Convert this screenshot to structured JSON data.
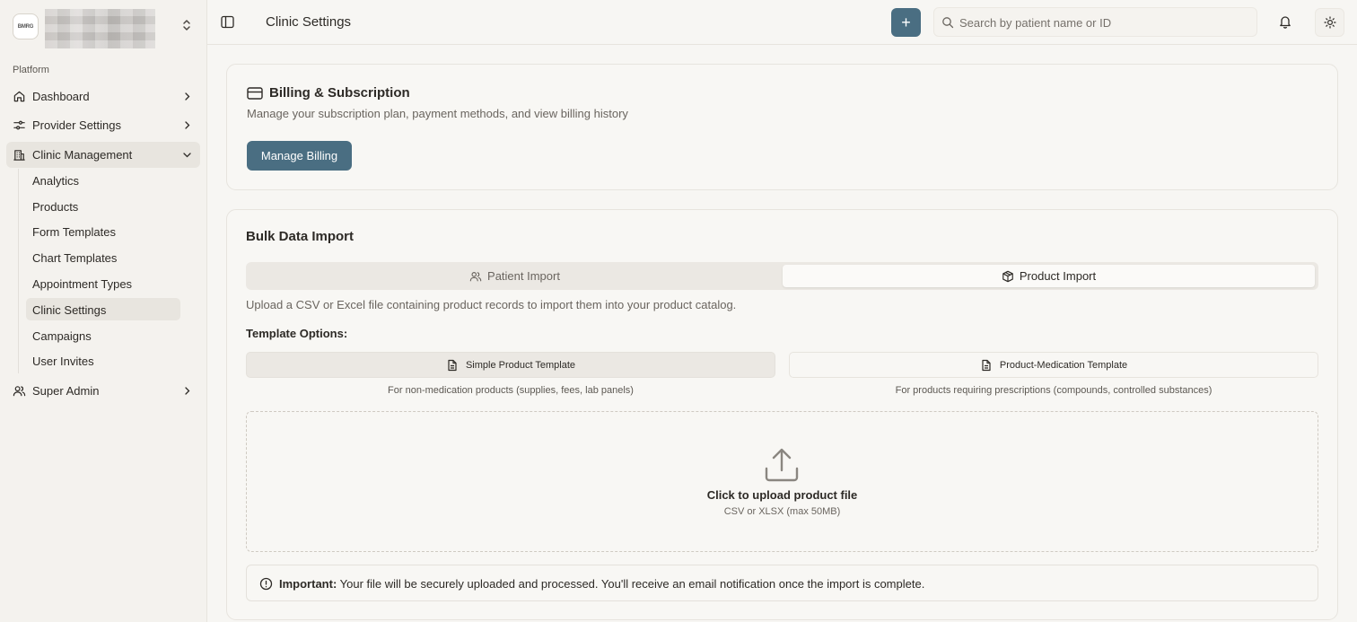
{
  "org": {
    "logo_text": "BMRG"
  },
  "sidebar": {
    "section_label": "Platform",
    "items": [
      {
        "label": "Dashboard",
        "icon": "home-icon"
      },
      {
        "label": "Provider Settings",
        "icon": "sliders-icon"
      },
      {
        "label": "Clinic Management",
        "icon": "building-icon"
      },
      {
        "label": "Super Admin",
        "icon": "users-icon"
      }
    ],
    "sub_items": [
      {
        "label": "Analytics"
      },
      {
        "label": "Products"
      },
      {
        "label": "Form Templates"
      },
      {
        "label": "Chart Templates"
      },
      {
        "label": "Appointment Types"
      },
      {
        "label": "Clinic Settings"
      },
      {
        "label": "Campaigns"
      },
      {
        "label": "User Invites"
      }
    ]
  },
  "header": {
    "title": "Clinic Settings",
    "add_label": "+",
    "search_placeholder": "Search by patient name or ID"
  },
  "billing": {
    "title": "Billing & Subscription",
    "description": "Manage your subscription plan, payment methods, and view billing history",
    "button_label": "Manage Billing"
  },
  "import": {
    "title": "Bulk Data Import",
    "tabs": [
      {
        "label": "Patient Import"
      },
      {
        "label": "Product Import"
      }
    ],
    "description": "Upload a CSV or Excel file containing product records to import them into your product catalog.",
    "template_label": "Template Options:",
    "templates": [
      {
        "label": "Simple Product Template",
        "note": "For non-medication products (supplies, fees, lab panels)"
      },
      {
        "label": "Product-Medication Template",
        "note": "For products requiring prescriptions (compounds, controlled substances)"
      }
    ],
    "upload_title": "Click to upload product file",
    "upload_hint": "CSV or XLSX (max 50MB)",
    "notice_bold": "Important:",
    "notice_text": " Your file will be securely uploaded and processed. You'll receive an email notification once the import is complete."
  },
  "colors": {
    "accent": "#4a6e82",
    "background": "#f7f6f3",
    "sidebar": "#f4f2ee"
  }
}
